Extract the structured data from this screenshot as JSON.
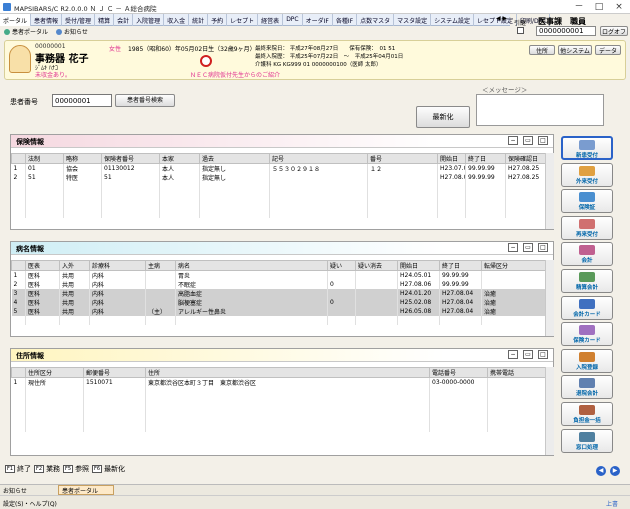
{
  "window": {
    "title": "MAPSIBARS/C R2.0.0.0 Ｎ Ｊ Ｃ － Ａ総合病院",
    "min": "－",
    "max": "□",
    "close": "×"
  },
  "menus": [
    "ポータル",
    "患者情報",
    "受付/管理",
    "精算",
    "会計",
    "入院管理",
    "収入金",
    "統計",
    "予約",
    "レセプト",
    "経営表",
    "DPC",
    "オーダIF",
    "各種IF",
    "点数マスタ",
    "マスタ設定",
    "システム設定",
    "レセプト設定",
    "印刷/DPC"
  ],
  "menu_more": "◀ ▶",
  "subtabs": [
    {
      "label": "患者ポータル"
    },
    {
      "label": "お知らせ"
    }
  ],
  "top_right": {
    "dept": "医事課　職員",
    "id": "0000000001",
    "logout": "ログオフ",
    "lock": "引継"
  },
  "patient": {
    "id": "00000001",
    "name": "事務器 花子",
    "kana": "ｼﾞﾑｷ ﾊﾅｺ",
    "note": "未収金あり。",
    "gender": "女性",
    "birth": "1985（昭和60）年05月02日生（32歳9ヶ月）",
    "line1": "最終来院日： 平成27年08月27日　　保有保険：　01 51",
    "line2": "最終入院歴： 平成25年07月22日　～　平成25年04月01日",
    "line3": "介護科 KG KG999 01 0000000100（医師 太郎）",
    "message": "ＮＥＣ病院仮付先生からのご紹介",
    "btns": [
      "住所",
      "他システム",
      "データ"
    ]
  },
  "search": {
    "label": "患者番号",
    "value": "00000001",
    "btn": "患者番号検索",
    "refresh": "最新化",
    "msg_label": "＜メッセージ＞"
  },
  "hoken": {
    "title": "保険情報",
    "headers": [
      "法制",
      "略称",
      "保険者番号",
      "本家",
      "過去",
      "記号",
      "番号",
      "開始日",
      "終了日",
      "保険確認日"
    ],
    "rows": [
      [
        "01",
        "協会",
        "01130012",
        "本人",
        "指定無し",
        "５５３０２９１８",
        "１２",
        "H23.07.01",
        "99.99.99",
        "H27.08.25"
      ],
      [
        "51",
        "特医",
        "51",
        "本人",
        "指定無し",
        "",
        "",
        "H27.08.01",
        "99.99.99",
        "H27.08.25"
      ]
    ]
  },
  "byomei": {
    "title": "病名情報",
    "headers": [
      "医表",
      "入外",
      "診療科",
      "主病",
      "病名",
      "疑い",
      "疑い消去",
      "開始日",
      "終了日",
      "転帰区分"
    ],
    "rows": [
      [
        "医科",
        "共用",
        "内科",
        "",
        "胃炎",
        "",
        "",
        "H24.05.01",
        "99.99.99",
        ""
      ],
      [
        "医科",
        "共用",
        "内科",
        "",
        "不眠症",
        "0",
        "",
        "H27.08.06",
        "99.99.99",
        ""
      ],
      [
        "医科",
        "共用",
        "内科",
        "",
        "高脂血症",
        "",
        "",
        "H24.01.20",
        "H27.08.04",
        "治癒"
      ],
      [
        "医科",
        "共用",
        "内科",
        "",
        "脳梗塞症",
        "0",
        "",
        "H25.02.08",
        "H27.08.04",
        "治癒"
      ],
      [
        "医科",
        "共用",
        "内科",
        "（主）",
        "アレルギー性鼻炎",
        "",
        "",
        "H26.05.08",
        "H27.08.04",
        "治癒"
      ]
    ]
  },
  "jusho": {
    "title": "住所情報",
    "headers": [
      "住所区分",
      "郵便番号",
      "住所",
      "電話番号",
      "携帯電話"
    ],
    "rows": [
      [
        "現住所",
        "1510071",
        "東京都渋谷区本町３丁目　東京都渋谷区",
        "03-0000-0000",
        ""
      ]
    ]
  },
  "side_buttons": [
    "新患受付",
    "外来受付",
    "保険証",
    "再来受付",
    "会計",
    "精算会計",
    "会計カード",
    "保険カード",
    "入院登録",
    "退院会計",
    "負担金一括",
    "窓口処理"
  ],
  "fkeys": [
    {
      "key": "F1",
      "label": "終了"
    },
    {
      "key": "F2",
      "label": "業務"
    },
    {
      "key": "F5",
      "label": "参照"
    },
    {
      "key": "F6",
      "label": "最新化"
    }
  ],
  "status": {
    "left": "お知らせ",
    "tab": "患者ポータル",
    "menu": "設定(S)・ヘルプ(Q)",
    "right": "上書"
  }
}
